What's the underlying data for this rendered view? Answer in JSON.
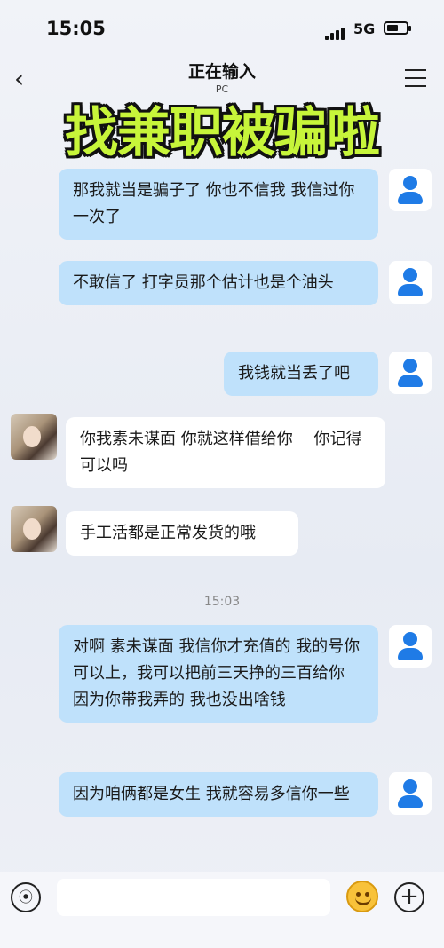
{
  "status_bar": {
    "time": "15:05",
    "network": "5G"
  },
  "header": {
    "title": "正在输入",
    "subtitle": "PC"
  },
  "banner": "找兼职被骗啦",
  "timestamp": "15:03",
  "messages": [
    {
      "sender": "me",
      "text": "那我就当是骗子了 你也不信我 我信过你一次了"
    },
    {
      "sender": "me",
      "text": "不敢信了 打字员那个估计也是个油头"
    },
    {
      "sender": "me",
      "text": "我钱就当丢了吧"
    },
    {
      "sender": "them",
      "text": "你我素未谋面 你就这样借给你　 你记得可以吗"
    },
    {
      "sender": "them",
      "text": "手工活都是正常发货的哦"
    },
    {
      "sender": "me",
      "text": "对啊 素未谋面 我信你才充值的 我的号你可以上，我可以把前三天挣的三百给你 因为你带我弄的 我也没出啥钱"
    },
    {
      "sender": "me",
      "text": "因为咱俩都是女生 我就容易多信你一些"
    }
  ],
  "icons": {
    "back": "chevron-left-icon",
    "menu": "menu-icon",
    "voice": "voice-icon",
    "emoji": "emoji-icon",
    "plus": "plus-icon"
  },
  "colors": {
    "my_bubble": "#bfe1fb",
    "their_bubble": "#ffffff",
    "banner": "#c7f53a"
  }
}
